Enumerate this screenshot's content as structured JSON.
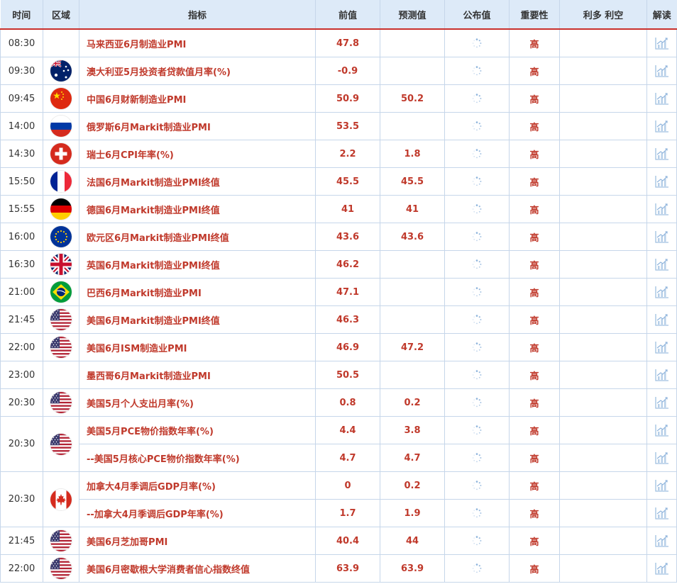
{
  "headers": {
    "time": "时间",
    "region": "区域",
    "indicator": "指标",
    "previous": "前值",
    "forecast": "预测值",
    "actual": "公布值",
    "importance": "重要性",
    "impact": "利多 利空",
    "analysis": "解读"
  },
  "rows": [
    {
      "time": "08:30",
      "flag": "none",
      "indicator": "马来西亚6月制造业PMI",
      "previous": "47.8",
      "forecast": "",
      "importance": "高"
    },
    {
      "time": "09:30",
      "flag": "australia",
      "indicator": "澳大利亚5月投资者贷款值月率(%)",
      "previous": "-0.9",
      "forecast": "",
      "importance": "高"
    },
    {
      "time": "09:45",
      "flag": "china",
      "indicator": "中国6月财新制造业PMI",
      "previous": "50.9",
      "forecast": "50.2",
      "importance": "高"
    },
    {
      "time": "14:00",
      "flag": "russia",
      "indicator": "俄罗斯6月Markit制造业PMI",
      "previous": "53.5",
      "forecast": "",
      "importance": "高"
    },
    {
      "time": "14:30",
      "flag": "switzerland",
      "indicator": "瑞士6月CPI年率(%)",
      "previous": "2.2",
      "forecast": "1.8",
      "importance": "高"
    },
    {
      "time": "15:50",
      "flag": "france",
      "indicator": "法国6月Markit制造业PMI终值",
      "previous": "45.5",
      "forecast": "45.5",
      "importance": "高"
    },
    {
      "time": "15:55",
      "flag": "germany",
      "indicator": "德国6月Markit制造业PMI终值",
      "previous": "41",
      "forecast": "41",
      "importance": "高"
    },
    {
      "time": "16:00",
      "flag": "eu",
      "indicator": "欧元区6月Markit制造业PMI终值",
      "previous": "43.6",
      "forecast": "43.6",
      "importance": "高"
    },
    {
      "time": "16:30",
      "flag": "uk",
      "indicator": "英国6月Markit制造业PMI终值",
      "previous": "46.2",
      "forecast": "",
      "importance": "高"
    },
    {
      "time": "21:00",
      "flag": "brazil",
      "indicator": "巴西6月Markit制造业PMI",
      "previous": "47.1",
      "forecast": "",
      "importance": "高"
    },
    {
      "time": "21:45",
      "flag": "usa",
      "indicator": "美国6月Markit制造业PMI终值",
      "previous": "46.3",
      "forecast": "",
      "importance": "高"
    },
    {
      "time": "22:00",
      "flag": "usa",
      "indicator": "美国6月ISM制造业PMI",
      "previous": "46.9",
      "forecast": "47.2",
      "importance": "高"
    },
    {
      "time": "23:00",
      "flag": "none",
      "indicator": "墨西哥6月Markit制造业PMI",
      "previous": "50.5",
      "forecast": "",
      "importance": "高"
    },
    {
      "time": "20:30",
      "flag": "usa",
      "indicator": "美国5月个人支出月率(%)",
      "previous": "0.8",
      "forecast": "0.2",
      "importance": "高"
    },
    {
      "time": "20:30",
      "flag": "usa",
      "rowspan": 2,
      "indicator": "美国5月PCE物价指数年率(%)",
      "previous": "4.4",
      "forecast": "3.8",
      "importance": "高"
    },
    {
      "time": "",
      "flag": "",
      "continued": true,
      "indicator": "--美国5月核心PCE物价指数年率(%)",
      "previous": "4.7",
      "forecast": "4.7",
      "importance": "高"
    },
    {
      "time": "20:30",
      "flag": "canada",
      "rowspan": 2,
      "indicator": "加拿大4月季调后GDP月率(%)",
      "previous": "0",
      "forecast": "0.2",
      "importance": "高"
    },
    {
      "time": "",
      "flag": "",
      "continued": true,
      "indicator": "--加拿大4月季调后GDP年率(%)",
      "previous": "1.7",
      "forecast": "1.9",
      "importance": "高"
    },
    {
      "time": "21:45",
      "flag": "usa",
      "indicator": "美国6月芝加哥PMI",
      "previous": "40.4",
      "forecast": "44",
      "importance": "高"
    },
    {
      "time": "22:00",
      "flag": "usa",
      "indicator": "美国6月密歇根大学消费者信心指数终值",
      "previous": "63.9",
      "forecast": "63.9",
      "importance": "高"
    }
  ],
  "icons": {
    "actual_pending": "loading-spinner-icon",
    "analysis": "chart-analysis-icon"
  },
  "colors": {
    "header_bg": "#ddeaf8",
    "accent_red": "#c0392b",
    "grid": "#c6d6ea",
    "icon_blue": "#8fb4dc"
  }
}
